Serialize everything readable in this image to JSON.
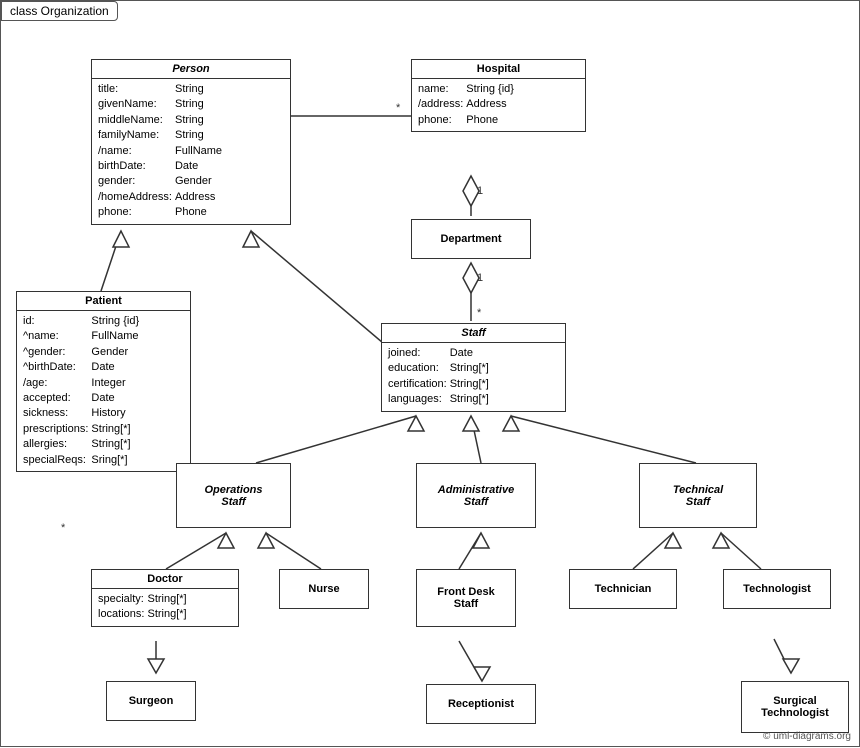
{
  "title": "class Organization",
  "classes": {
    "person": {
      "name": "Person",
      "attrs": [
        [
          "title:",
          "String"
        ],
        [
          "givenName:",
          "String"
        ],
        [
          "middleName:",
          "String"
        ],
        [
          "familyName:",
          "String"
        ],
        [
          "/name:",
          "FullName"
        ],
        [
          "birthDate:",
          "Date"
        ],
        [
          "gender:",
          "Gender"
        ],
        [
          "/homeAddress:",
          "Address"
        ],
        [
          "phone:",
          "Phone"
        ]
      ]
    },
    "hospital": {
      "name": "Hospital",
      "attrs": [
        [
          "name:",
          "String {id}"
        ],
        [
          "/address:",
          "Address"
        ],
        [
          "phone:",
          "Phone"
        ]
      ]
    },
    "patient": {
      "name": "Patient",
      "attrs": [
        [
          "id:",
          "String {id}"
        ],
        [
          "^name:",
          "FullName"
        ],
        [
          "^gender:",
          "Gender"
        ],
        [
          "^birthDate:",
          "Date"
        ],
        [
          "/age:",
          "Integer"
        ],
        [
          "accepted:",
          "Date"
        ],
        [
          "sickness:",
          "History"
        ],
        [
          "prescriptions:",
          "String[*]"
        ],
        [
          "allergies:",
          "String[*]"
        ],
        [
          "specialReqs:",
          "Sring[*]"
        ]
      ]
    },
    "department": {
      "name": "Department"
    },
    "staff": {
      "name": "Staff",
      "attrs": [
        [
          "joined:",
          "Date"
        ],
        [
          "education:",
          "String[*]"
        ],
        [
          "certification:",
          "String[*]"
        ],
        [
          "languages:",
          "String[*]"
        ]
      ]
    },
    "operations_staff": {
      "name": "Operations\nStaff"
    },
    "administrative_staff": {
      "name": "Administrative\nStaff"
    },
    "technical_staff": {
      "name": "Technical\nStaff"
    },
    "doctor": {
      "name": "Doctor",
      "attrs": [
        [
          "specialty:",
          "String[*]"
        ],
        [
          "locations:",
          "String[*]"
        ]
      ]
    },
    "nurse": {
      "name": "Nurse"
    },
    "front_desk_staff": {
      "name": "Front Desk\nStaff"
    },
    "technician": {
      "name": "Technician"
    },
    "technologist": {
      "name": "Technologist"
    },
    "surgeon": {
      "name": "Surgeon"
    },
    "receptionist": {
      "name": "Receptionist"
    },
    "surgical_technologist": {
      "name": "Surgical\nTechnologist"
    }
  },
  "multiplicity": {
    "star": "*",
    "one": "1"
  },
  "copyright": "© uml-diagrams.org"
}
